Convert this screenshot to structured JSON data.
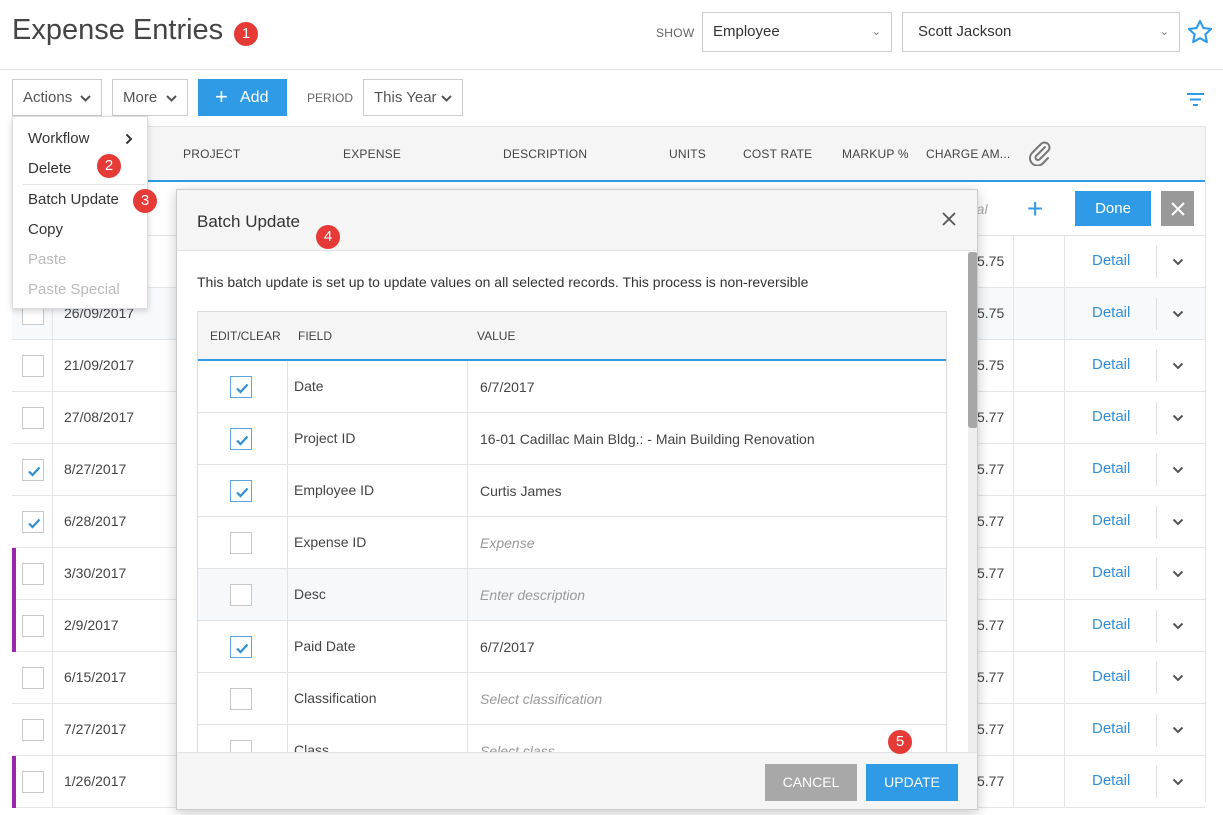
{
  "header": {
    "title": "Expense Entries",
    "show_label": "SHOW",
    "show_type": "Employee",
    "show_person": "Scott Jackson"
  },
  "toolbar": {
    "actions_label": "Actions",
    "more_label": "More",
    "add_label": "Add",
    "period_label": "PERIOD",
    "period_value": "This Year"
  },
  "grid": {
    "columns": [
      "PROJECT",
      "EXPENSE",
      "DESCRIPTION",
      "UNITS",
      "COST RATE",
      "MARKUP %",
      "CHARGE AM..."
    ],
    "total_placeholder": "otal",
    "done_label": "Done",
    "detail_label": "Detail",
    "rows": [
      {
        "date": "",
        "amount": "5.75",
        "checked": false,
        "flag": false
      },
      {
        "date": "26/09/2017",
        "amount": "5.75",
        "checked": false,
        "flag": false
      },
      {
        "date": "21/09/2017",
        "amount": "5.75",
        "checked": false,
        "flag": false
      },
      {
        "date": "27/08/2017",
        "amount": "5.77",
        "checked": false,
        "flag": false
      },
      {
        "date": "8/27/2017",
        "amount": "5.77",
        "checked": true,
        "flag": false
      },
      {
        "date": "6/28/2017",
        "amount": "5.77",
        "checked": true,
        "flag": false
      },
      {
        "date": "3/30/2017",
        "amount": "5.77",
        "checked": false,
        "flag": true
      },
      {
        "date": "2/9/2017",
        "amount": "5.77",
        "checked": false,
        "flag": true
      },
      {
        "date": "6/15/2017",
        "amount": "5.77",
        "checked": false,
        "flag": false
      },
      {
        "date": "7/27/2017",
        "amount": "5.77",
        "checked": false,
        "flag": false
      },
      {
        "date": "1/26/2017",
        "amount": "5.77",
        "checked": false,
        "flag": true
      }
    ]
  },
  "actions_menu": {
    "items": [
      {
        "label": "Workflow",
        "disabled": false
      },
      {
        "label": "Delete",
        "disabled": false
      },
      {
        "label": "Batch Update",
        "disabled": false
      },
      {
        "label": "Copy",
        "disabled": false
      },
      {
        "label": "Paste",
        "disabled": true
      },
      {
        "label": "Paste Special",
        "disabled": true
      }
    ]
  },
  "modal": {
    "title": "Batch Update",
    "intro": "This batch update is set up to update values on all selected records. This process is non-reversible",
    "col_edit": "EDIT/CLEAR",
    "col_field": "FIELD",
    "col_value": "VALUE",
    "fields": [
      {
        "field": "Date",
        "value": "6/7/2017",
        "checked": true,
        "placeholder": false
      },
      {
        "field": "Project ID",
        "value": "16-01 Cadillac Main Bldg.: - Main Building Renovation",
        "checked": true,
        "placeholder": false
      },
      {
        "field": "Employee ID",
        "value": "Curtis James",
        "checked": true,
        "placeholder": false
      },
      {
        "field": "Expense ID",
        "value": "Expense",
        "checked": false,
        "placeholder": true
      },
      {
        "field": "Desc",
        "value": "Enter description",
        "checked": false,
        "placeholder": true
      },
      {
        "field": "Paid Date",
        "value": "6/7/2017",
        "checked": true,
        "placeholder": false
      },
      {
        "field": "Classification",
        "value": "Select classification",
        "checked": false,
        "placeholder": true
      },
      {
        "field": "Class",
        "value": "Select class",
        "checked": false,
        "placeholder": true
      }
    ],
    "cancel_label": "CANCEL",
    "update_label": "UPDATE"
  },
  "badges": [
    "1",
    "2",
    "3",
    "4",
    "5"
  ],
  "colors": {
    "accent": "#2f9be6",
    "badge": "#e53a35",
    "flag": "#9b27af"
  }
}
